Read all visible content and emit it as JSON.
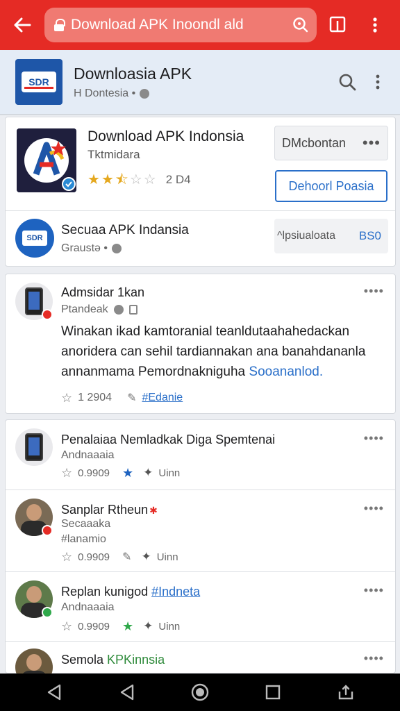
{
  "browser": {
    "url": "Download APK Inoondl ald",
    "colors": {
      "toolbar": "#e52b25",
      "url_box": "#f07a72"
    }
  },
  "site": {
    "logo_text": "SDR",
    "title": "Downloasia APK",
    "subtitle": "H Dontesia •"
  },
  "app": {
    "title": "Download APK Indonsia",
    "developer": "Tktmidara",
    "rating": 2.5,
    "rating_max": 5,
    "rating_count": "2 D4",
    "download_label": "DMcbontan",
    "download_more": "•••",
    "outline_button": "Dehoorl Poasia"
  },
  "source": {
    "logo_text": "SDR",
    "name": "Secuaa APK Indansia",
    "meta": "Graustə •",
    "button_label": "^lpsiualoata",
    "button_number": "BS0"
  },
  "post": {
    "author": "Admsidar 1kan",
    "meta": "Ptandeak",
    "more": "••••",
    "body_text": "Winakan ikad kamtoranial teanldutaahahedackan anoridera can sehil tardiannakan ana banahdananla annanmama Pemordnakniguha",
    "body_link": "Sooananlod.",
    "count": "1 2904",
    "tag": "#Edanie"
  },
  "feed": [
    {
      "name": "Penalaiaa Nemladkak Diga Spemtenai",
      "sub": "Andnaaaia",
      "count": "0.9909",
      "third": "Uinn",
      "more": "••••"
    },
    {
      "name": "Sanplar Rtheun",
      "sub1": "Secaaaka",
      "sub2": "#lanamio",
      "count": "0.9909",
      "third": "Uinn",
      "more": "••••"
    },
    {
      "name": "Replan kunigod",
      "name_tag": "#Indneta",
      "sub": "Andnaaaia",
      "count": "0.9909",
      "third": "Uinn",
      "more": "••••"
    },
    {
      "name": "Semola",
      "name_highlight": "KPKinnsia",
      "more": "••••"
    }
  ]
}
